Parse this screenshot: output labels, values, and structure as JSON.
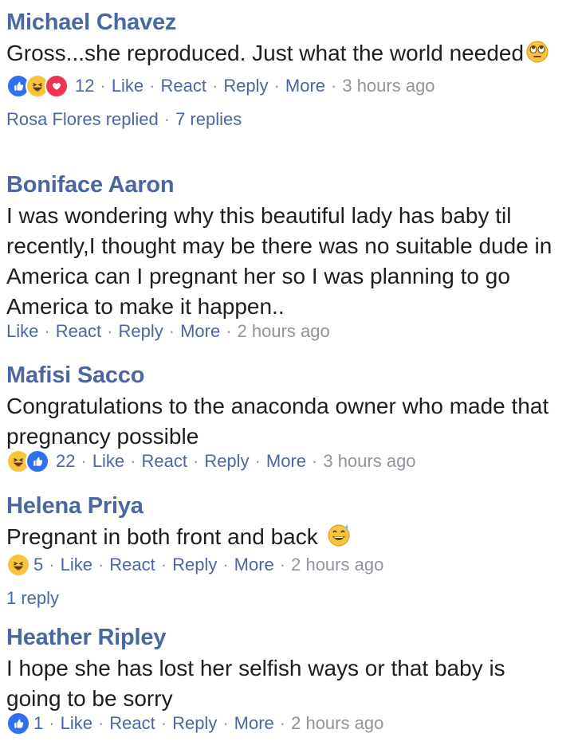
{
  "comments": [
    {
      "author": "Michael Chavez",
      "text": "Gross...she reproduced. Just what the world needed",
      "reaction_count": "12",
      "actions": [
        "Like",
        "React",
        "Reply",
        "More"
      ],
      "time": "3 hours ago",
      "replies_summary": {
        "who": "Rosa Flores replied",
        "count": "7 replies"
      }
    },
    {
      "author": "Boniface Aaron",
      "text": "I was wondering why this beautiful lady has baby til recently,I thought may be there was no suitable dude in America can I pregnant her so I was planning to go America to make it happen..",
      "actions": [
        "Like",
        "React",
        "Reply",
        "More"
      ],
      "time": "2 hours ago"
    },
    {
      "author": "Mafisi Sacco",
      "text": "Congratulations to the anaconda owner who made that pregnancy possible",
      "reaction_count": "22",
      "actions": [
        "Like",
        "React",
        "Reply",
        "More"
      ],
      "time": "3 hours ago"
    },
    {
      "author": "Helena Priya",
      "text": "Pregnant in both front and back",
      "reaction_count": "5",
      "actions": [
        "Like",
        "React",
        "Reply",
        "More"
      ],
      "time": "2 hours ago",
      "replies_summary": {
        "count": "1 reply"
      }
    },
    {
      "author": "Heather Ripley",
      "text": "I hope she has lost her selfish ways or that baby is going to be sorry",
      "reaction_count": "1",
      "actions": [
        "Like",
        "React",
        "Reply",
        "More"
      ],
      "time": "2 hours ago"
    }
  ],
  "icons": {
    "reactions_c1": [
      "like-reaction-icon",
      "haha-reaction-icon",
      "love-reaction-icon"
    ],
    "reactions_c3": [
      "haha-reaction-icon",
      "like-reaction-icon"
    ],
    "reactions_c4": [
      "haha-reaction-icon"
    ],
    "reactions_c5": [
      "like-reaction-icon"
    ],
    "emoji_c1": "eye-roll-emoji-icon",
    "emoji_c4": "sweat-smile-emoji-icon"
  },
  "colors": {
    "author": "#4b67a1",
    "link": "#4b67a1",
    "muted": "#90949c",
    "like": "#2f6ff0",
    "haha": "#f7c43b",
    "love": "#ee3452"
  }
}
